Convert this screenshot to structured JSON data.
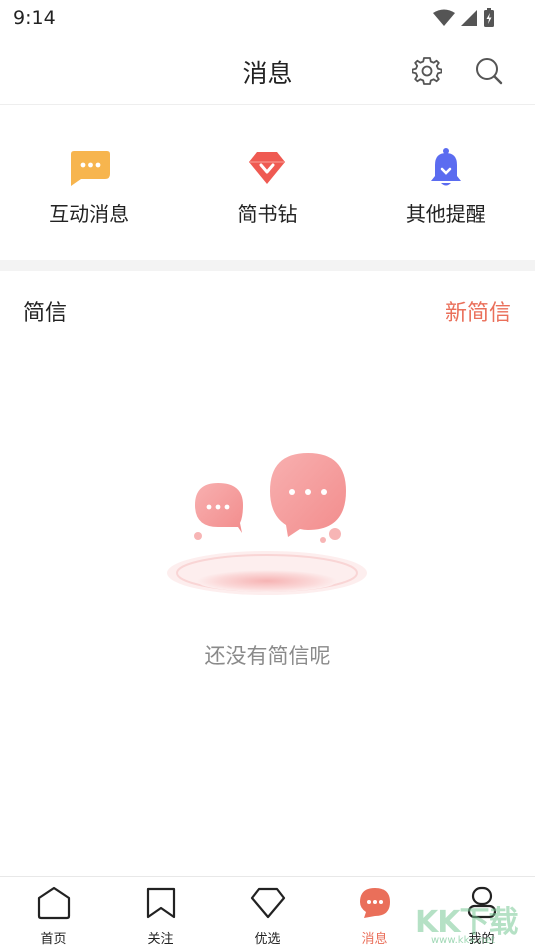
{
  "status_bar": {
    "time": "9:14"
  },
  "header": {
    "title": "消息"
  },
  "quick_actions": [
    {
      "label": "互动消息",
      "icon": "chat-bubble-icon",
      "color": "#f7b54e"
    },
    {
      "label": "简书钻",
      "icon": "diamond-icon",
      "color": "#ef5a52"
    },
    {
      "label": "其他提醒",
      "icon": "bell-icon",
      "color": "#5b6cf0"
    }
  ],
  "messages_section": {
    "title": "简信",
    "action_label": "新简信"
  },
  "empty_state": {
    "text": "还没有简信呢"
  },
  "tab_bar": {
    "items": [
      {
        "label": "首页",
        "icon": "home-icon",
        "active": false
      },
      {
        "label": "关注",
        "icon": "bookmark-icon",
        "active": false
      },
      {
        "label": "优选",
        "icon": "diamond-outline-icon",
        "active": false
      },
      {
        "label": "消息",
        "icon": "message-icon",
        "active": true
      },
      {
        "label": "我的",
        "icon": "profile-icon",
        "active": false
      }
    ]
  },
  "watermark": {
    "brand": "KK下载",
    "domain": "www.kkx.net"
  },
  "colors": {
    "accent": "#ea6f5a",
    "text": "#222222",
    "muted": "#8a8a8a"
  }
}
